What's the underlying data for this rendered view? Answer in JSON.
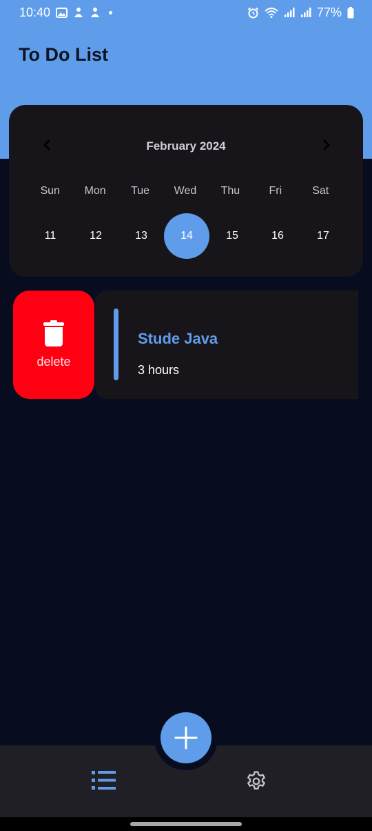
{
  "status_bar": {
    "time": "10:40",
    "battery": "77%"
  },
  "app": {
    "title": "To Do List"
  },
  "calendar": {
    "month_label": "February 2024",
    "weekdays": [
      "Sun",
      "Mon",
      "Tue",
      "Wed",
      "Thu",
      "Fri",
      "Sat"
    ],
    "days": [
      "11",
      "12",
      "13",
      "14",
      "15",
      "16",
      "17"
    ],
    "selected_day": "14"
  },
  "tasks": [
    {
      "title": "Stude Java",
      "duration": "3 hours",
      "delete_label": "delete"
    }
  ],
  "colors": {
    "accent": "#5f9deb",
    "delete": "#ff0012",
    "background": "#070d1f",
    "card": "#18151a",
    "bottom_nav": "#201f26"
  },
  "icons": {
    "prev_month": "chevron-left-icon",
    "next_month": "chevron-right-icon",
    "delete": "trash-icon",
    "add": "plus-icon",
    "list_tab": "list-icon",
    "settings_tab": "gear-icon"
  }
}
